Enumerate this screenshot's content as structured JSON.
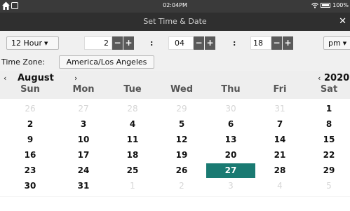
{
  "status": {
    "time": "02:04PM",
    "battery": "100%"
  },
  "title": "Set Time & Date",
  "controls": {
    "format": "12 Hour",
    "hour": "2",
    "minute": "04",
    "second": "18",
    "ampm": "pm",
    "minus": "−",
    "plus": "+",
    "colon": ":"
  },
  "timezone": {
    "label": "Time Zone:",
    "value": "America/Los Angeles"
  },
  "calendar": {
    "month": "August",
    "year": "2020",
    "prev": "‹",
    "next": "›",
    "weekdays": [
      "Sun",
      "Mon",
      "Tue",
      "Wed",
      "Thu",
      "Fri",
      "Sat"
    ],
    "weeks": [
      [
        "26",
        "27",
        "28",
        "29",
        "30",
        "31",
        "1"
      ],
      [
        "2",
        "3",
        "4",
        "5",
        "6",
        "7",
        "8"
      ],
      [
        "9",
        "10",
        "11",
        "12",
        "13",
        "14",
        "15"
      ],
      [
        "16",
        "17",
        "18",
        "19",
        "20",
        "21",
        "22"
      ],
      [
        "23",
        "24",
        "25",
        "26",
        "27",
        "28",
        "29"
      ],
      [
        "30",
        "31",
        "1",
        "2",
        "3",
        "4",
        "5"
      ]
    ],
    "selected": "27"
  }
}
